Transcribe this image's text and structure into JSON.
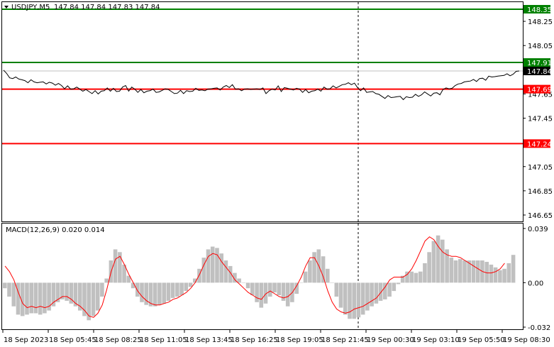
{
  "header": {
    "symbol": "USDJPY,M5",
    "ohlc": "147.84 147.84 147.83 147.84",
    "menu_icon": "triangle-down-icon"
  },
  "indicator": {
    "label": "MACD(12,26,9) 0.020 0.014"
  },
  "colors": {
    "price_line": "#000000",
    "green_level": "#008000",
    "red_level": "#ff0000",
    "macd_hist": "#c0c0c0",
    "signal": "#ff0000",
    "current_price_tag": "#000000"
  },
  "chart_data": [
    {
      "type": "line",
      "title": "USDJPY,M5",
      "ylim": [
        146.6,
        148.4
      ],
      "y_ticks": [
        "148.35",
        "148.25",
        "148.05",
        "147.91",
        "147.84",
        "147.69",
        "147.65",
        "147.45",
        "147.24",
        "147.05",
        "146.85",
        "146.65"
      ],
      "levels": [
        {
          "value": 148.35,
          "label": "148.35",
          "color": "green"
        },
        {
          "value": 147.91,
          "label": "147.91",
          "color": "green"
        },
        {
          "value": 147.69,
          "label": "147.69",
          "color": "red"
        },
        {
          "value": 147.24,
          "label": "147.24",
          "color": "red"
        }
      ],
      "current_price": {
        "value": 147.84,
        "label": "147.84"
      },
      "x_labels": [
        "18 Sep 2023",
        "18 Sep 05:45",
        "18 Sep 08:25",
        "18 Sep 11:05",
        "18 Sep 13:45",
        "18 Sep 16:25",
        "18 Sep 19:05",
        "18 Sep 21:45",
        "19 Sep 00:30",
        "19 Sep 03:10",
        "19 Sep 05:50",
        "19 Sep 08:30"
      ],
      "series": [
        {
          "values": [
            147.84,
            147.82,
            147.79,
            147.77,
            147.79,
            147.78,
            147.76,
            147.76,
            147.75,
            147.76,
            147.75,
            147.75,
            147.74,
            147.75,
            147.74,
            147.74,
            147.74,
            147.73,
            147.73,
            147.72,
            147.7,
            147.71,
            147.69,
            147.7,
            147.7,
            147.69,
            147.68,
            147.68,
            147.67,
            147.66,
            147.67,
            147.65,
            147.68,
            147.67,
            147.7,
            147.68,
            147.69,
            147.67,
            147.68,
            147.7,
            147.72,
            147.68,
            147.7,
            147.69,
            147.67,
            147.68,
            147.66,
            147.68,
            147.67,
            147.69,
            147.67,
            147.66,
            147.68,
            147.7,
            147.68,
            147.67,
            147.66,
            147.65,
            147.68,
            147.66,
            147.67,
            147.67,
            147.68,
            147.69,
            147.68,
            147.69,
            147.67,
            147.69,
            147.7,
            147.69,
            147.7,
            147.69,
            147.7,
            147.72,
            147.71,
            147.72,
            147.69,
            147.7,
            147.67,
            147.69,
            147.7,
            147.68,
            147.69,
            147.7,
            147.68,
            147.7,
            147.66,
            147.67,
            147.69,
            147.69,
            147.71,
            147.67,
            147.71,
            147.69,
            147.69,
            147.69,
            147.69,
            147.69,
            147.67,
            147.68,
            147.66,
            147.68,
            147.67,
            147.69,
            147.68,
            147.7,
            147.69,
            147.7,
            147.71,
            147.7,
            147.72,
            147.72,
            147.73,
            147.75,
            147.72,
            147.74,
            147.71,
            147.67,
            147.7,
            147.67,
            147.66,
            147.67,
            147.66,
            147.64,
            147.63,
            147.62,
            147.63,
            147.62,
            147.63,
            147.62,
            147.63,
            147.61,
            147.62,
            147.62,
            147.63,
            147.64,
            147.63,
            147.65,
            147.66,
            147.65,
            147.64,
            147.65,
            147.66,
            147.65,
            147.68,
            147.7,
            147.7,
            147.69,
            147.72,
            147.74,
            147.73,
            147.75,
            147.76,
            147.75,
            147.77,
            147.76,
            147.77,
            147.78,
            147.77,
            147.79,
            147.79,
            147.8,
            147.79,
            147.8,
            147.81,
            147.81,
            147.8,
            147.82,
            147.83,
            147.84
          ]
        }
      ]
    },
    {
      "type": "bar",
      "title": "MACD(12,26,9) 0.020 0.014",
      "ylim": [
        -0.032,
        0.039
      ],
      "y_ticks": [
        "0.039",
        "0.00",
        "-0.032"
      ],
      "series": [
        {
          "name": "MACD",
          "values": [
            -0.004,
            -0.01,
            -0.017,
            -0.023,
            -0.024,
            -0.023,
            -0.022,
            -0.022,
            -0.023,
            -0.022,
            -0.02,
            -0.017,
            -0.014,
            -0.012,
            -0.013,
            -0.015,
            -0.017,
            -0.02,
            -0.024,
            -0.027,
            -0.024,
            -0.02,
            -0.01,
            0.003,
            0.016,
            0.024,
            0.022,
            0.013,
            0.005,
            -0.004,
            -0.01,
            -0.014,
            -0.016,
            -0.017,
            -0.017,
            -0.016,
            -0.015,
            -0.013,
            -0.011,
            -0.01,
            -0.009,
            -0.006,
            -0.003,
            0.003,
            0.01,
            0.018,
            0.024,
            0.026,
            0.025,
            0.021,
            0.016,
            0.012,
            0.007,
            0.003,
            0.0,
            -0.004,
            -0.009,
            -0.014,
            -0.018,
            -0.015,
            -0.01,
            -0.007,
            -0.009,
            -0.013,
            -0.017,
            -0.014,
            -0.008,
            0.0,
            0.008,
            0.016,
            0.022,
            0.024,
            0.019,
            0.01,
            0.0,
            -0.01,
            -0.018,
            -0.023,
            -0.026,
            -0.026,
            -0.025,
            -0.023,
            -0.02,
            -0.017,
            -0.015,
            -0.013,
            -0.012,
            -0.01,
            -0.006,
            -0.001,
            0.005,
            0.008,
            0.008,
            0.007,
            0.008,
            0.014,
            0.022,
            0.03,
            0.034,
            0.031,
            0.024,
            0.018,
            0.016,
            0.017,
            0.016,
            0.016,
            0.016,
            0.016,
            0.016,
            0.015,
            0.013,
            0.011,
            0.009,
            0.01,
            0.014,
            0.02
          ]
        },
        {
          "name": "Signal",
          "values": [
            0.012,
            0.008,
            0.002,
            -0.007,
            -0.015,
            -0.018,
            -0.017,
            -0.018,
            -0.017,
            -0.018,
            -0.017,
            -0.014,
            -0.012,
            -0.01,
            -0.01,
            -0.012,
            -0.015,
            -0.017,
            -0.02,
            -0.024,
            -0.025,
            -0.022,
            -0.016,
            -0.005,
            0.008,
            0.017,
            0.019,
            0.013,
            0.006,
            0.0,
            -0.006,
            -0.01,
            -0.013,
            -0.015,
            -0.016,
            -0.016,
            -0.015,
            -0.014,
            -0.012,
            -0.011,
            -0.009,
            -0.007,
            -0.004,
            0.0,
            0.006,
            0.013,
            0.019,
            0.021,
            0.02,
            0.015,
            0.011,
            0.007,
            0.002,
            -0.001,
            -0.004,
            -0.007,
            -0.009,
            -0.011,
            -0.012,
            -0.008,
            -0.006,
            -0.008,
            -0.01,
            -0.011,
            -0.01,
            -0.007,
            -0.002,
            0.004,
            0.012,
            0.018,
            0.018,
            0.012,
            0.004,
            -0.006,
            -0.014,
            -0.019,
            -0.021,
            -0.022,
            -0.021,
            -0.019,
            -0.018,
            -0.017,
            -0.015,
            -0.013,
            -0.011,
            -0.007,
            -0.003,
            0.002,
            0.004,
            0.004,
            0.004,
            0.006,
            0.01,
            0.016,
            0.023,
            0.03,
            0.033,
            0.031,
            0.026,
            0.022,
            0.02,
            0.019,
            0.019,
            0.018,
            0.016,
            0.014,
            0.012,
            0.01,
            0.008,
            0.007,
            0.007,
            0.008,
            0.01,
            0.014
          ]
        }
      ]
    }
  ]
}
